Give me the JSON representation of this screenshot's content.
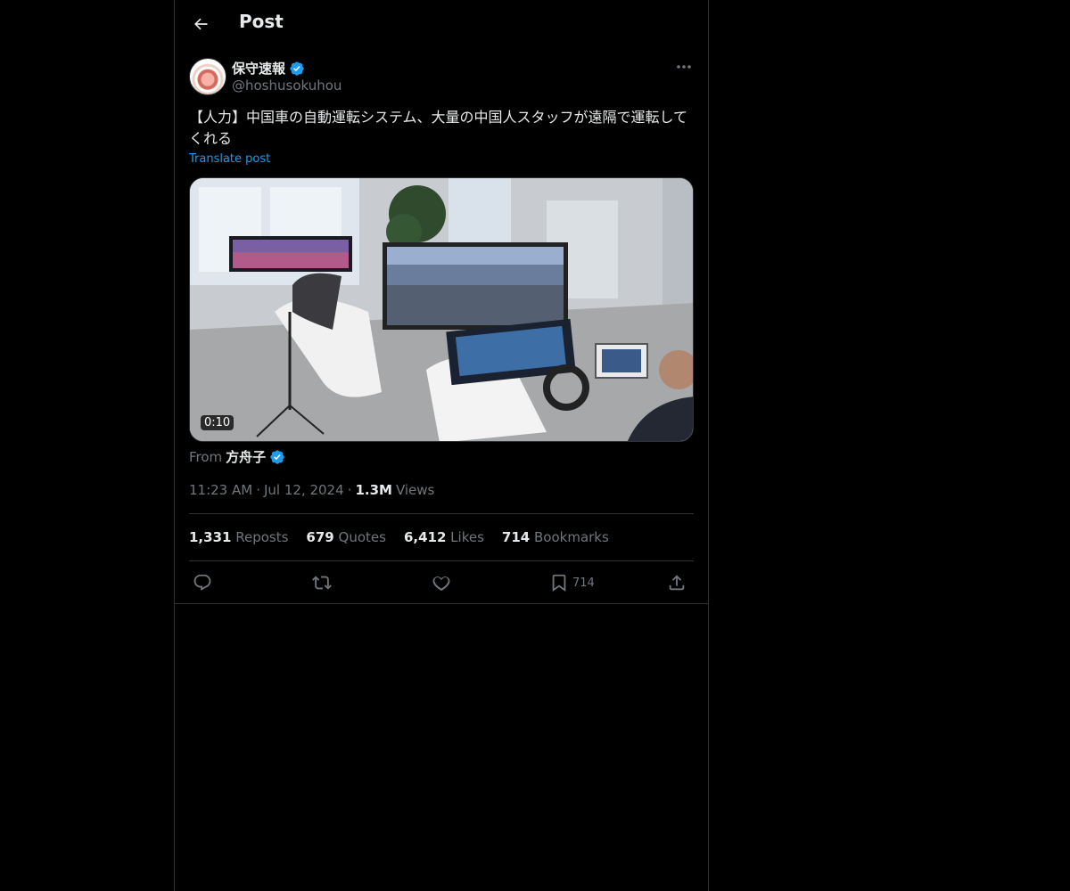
{
  "header": {
    "title": "Post",
    "back_icon": "arrow-left-icon"
  },
  "author": {
    "display_name": "保守速報",
    "handle": "@hoshusokuhou",
    "verified": true,
    "verified_color": "#1d9bf0"
  },
  "post": {
    "text": "【人力】中国車の自動運転システム、大量の中国人スタッフが遠隔で運転してくれる",
    "translate_label": "Translate post"
  },
  "media": {
    "duration": "0:10"
  },
  "source": {
    "prefix": "From",
    "name": "方舟子",
    "verified": true
  },
  "meta": {
    "time": "11:23 AM",
    "separator": "·",
    "date": "Jul 12, 2024",
    "views_count": "1.3M",
    "views_label": "Views"
  },
  "stats": [
    {
      "count": "1,331",
      "label": "Reposts"
    },
    {
      "count": "679",
      "label": "Quotes"
    },
    {
      "count": "6,412",
      "label": "Likes"
    },
    {
      "count": "714",
      "label": "Bookmarks"
    }
  ],
  "actions": {
    "reply_icon": "reply-icon",
    "repost_icon": "repost-icon",
    "like_icon": "heart-icon",
    "bookmark_icon": "bookmark-icon",
    "bookmark_count": "714",
    "share_icon": "share-icon"
  },
  "colors": {
    "background": "#000000",
    "text": "#e7e9ea",
    "muted": "#71767b",
    "accent": "#1d9bf0",
    "border": "#2f3336"
  }
}
